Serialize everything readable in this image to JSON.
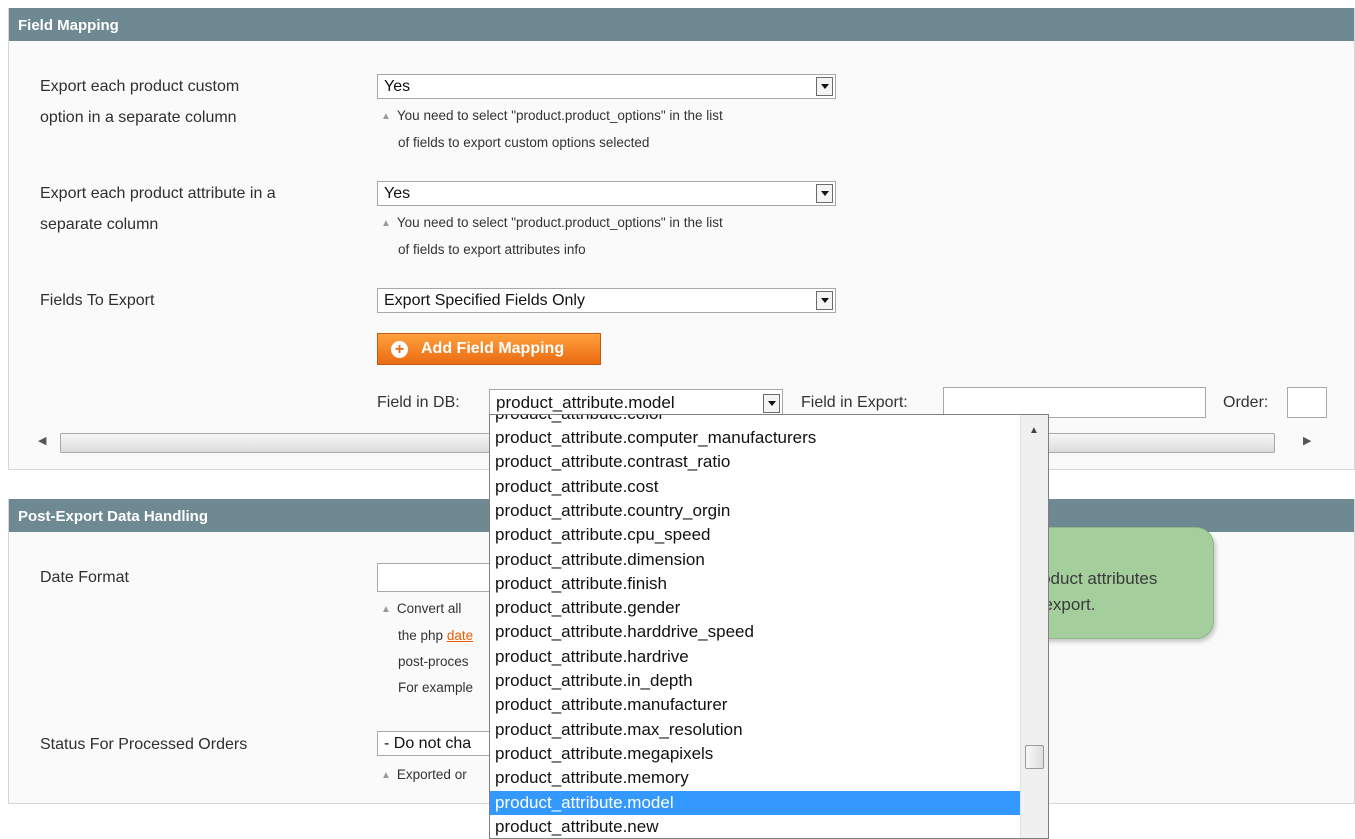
{
  "field_mapping": {
    "title": "Field Mapping",
    "custom_option": {
      "label_line1": "Export each product custom",
      "label_line2": "option in a separate column",
      "value": "Yes",
      "note_line1": "You need to select \"product.product_options\" in the list",
      "note_line2": "of fields to export custom options selected"
    },
    "attribute": {
      "label_line1": "Export each product attribute in a",
      "label_line2": "separate column",
      "value": "Yes",
      "note_line1": "You need to select \"product.product_options\" in the list",
      "note_line2": "of fields to export attributes info"
    },
    "fields_to_export": {
      "label": "Fields To Export",
      "value": "Export Specified Fields Only"
    },
    "add_button_label": "Add Field Mapping",
    "mapping_row": {
      "field_in_db_label": "Field in DB:",
      "field_in_db_value": "product_attribute.model",
      "field_in_export_label": "Field in Export:",
      "field_in_export_value": "",
      "order_label": "Order:",
      "order_value": ""
    }
  },
  "post_export": {
    "title": "Post-Export Data Handling",
    "date_format": {
      "label": "Date Format",
      "value": "",
      "note_line1": "Convert all",
      "note_line2_prefix": "the php",
      "note_line2_link": "date",
      "note_line3": "post-proces",
      "note_line4": "For example"
    },
    "status": {
      "label": "Status For Processed Orders",
      "value": "- Do not cha",
      "note": "Exported or"
    }
  },
  "dropdown": {
    "partial_top": "product_attribute.color",
    "items": [
      "product_attribute.computer_manufacturers",
      "product_attribute.contrast_ratio",
      "product_attribute.cost",
      "product_attribute.country_orgin",
      "product_attribute.cpu_speed",
      "product_attribute.dimension",
      "product_attribute.finish",
      "product_attribute.gender",
      "product_attribute.harddrive_speed",
      "product_attribute.hardrive",
      "product_attribute.in_depth",
      "product_attribute.manufacturer",
      "product_attribute.max_resolution",
      "product_attribute.megapixels",
      "product_attribute.memory",
      "product_attribute.model",
      "product_attribute.new"
    ],
    "selected_index": 15
  },
  "callout": {
    "line1": "Choose product attributes",
    "line2": "to export."
  },
  "colors": {
    "section_header": "#6f8992",
    "button_orange": "#eb6a11",
    "selection_blue": "#3399ff",
    "callout_green": "#a4cf9d"
  },
  "icons": [
    "dropdown-arrow-icon",
    "plus-circle-icon",
    "triangle-note-icon",
    "scroll-left-icon",
    "scroll-right-icon",
    "scroll-up-icon"
  ]
}
